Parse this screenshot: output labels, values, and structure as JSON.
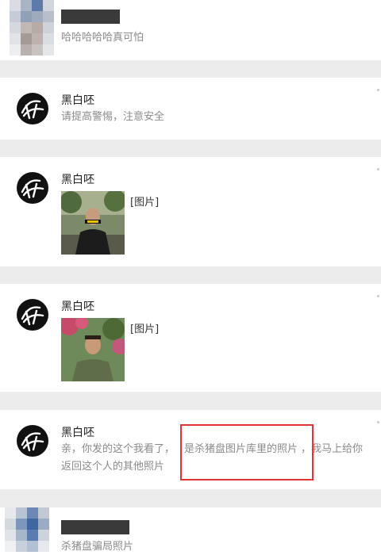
{
  "colors": {
    "background": "#ececec",
    "card": "#ffffff",
    "name_text": "#222222",
    "message_text": "#8a8a8a",
    "highlight_border": "#e03535",
    "redaction": "#3a3a3a"
  },
  "messages": [
    {
      "sender_name": "",
      "sender_redacted": true,
      "avatar": "pixelated-avatar-icon",
      "text": "哈哈哈哈哈真可怕"
    },
    {
      "sender_name": "黑白呸",
      "avatar": "ink-logo-avatar-icon",
      "text": "请提高警惕，注意安全"
    },
    {
      "sender_name": "黑白呸",
      "avatar": "ink-logo-avatar-icon",
      "image_tag": "[图片]",
      "image": "man-in-black-jacket-photo"
    },
    {
      "sender_name": "黑白呸",
      "avatar": "ink-logo-avatar-icon",
      "image_tag": "[图片]",
      "image": "man-in-green-shirt-photo"
    },
    {
      "sender_name": "黑白呸",
      "avatar": "ink-logo-avatar-icon",
      "text_part1": "亲，你发的这个我看了，",
      "text_highlight": "是杀猪盘图片库里的照片",
      "text_part2": "，我马上给你",
      "text_line2": "返回这个人的其他照片"
    },
    {
      "sender_name": "",
      "sender_redacted": true,
      "avatar": "pixelated-avatar-icon",
      "text": "杀猪盘骗局照片"
    }
  ]
}
